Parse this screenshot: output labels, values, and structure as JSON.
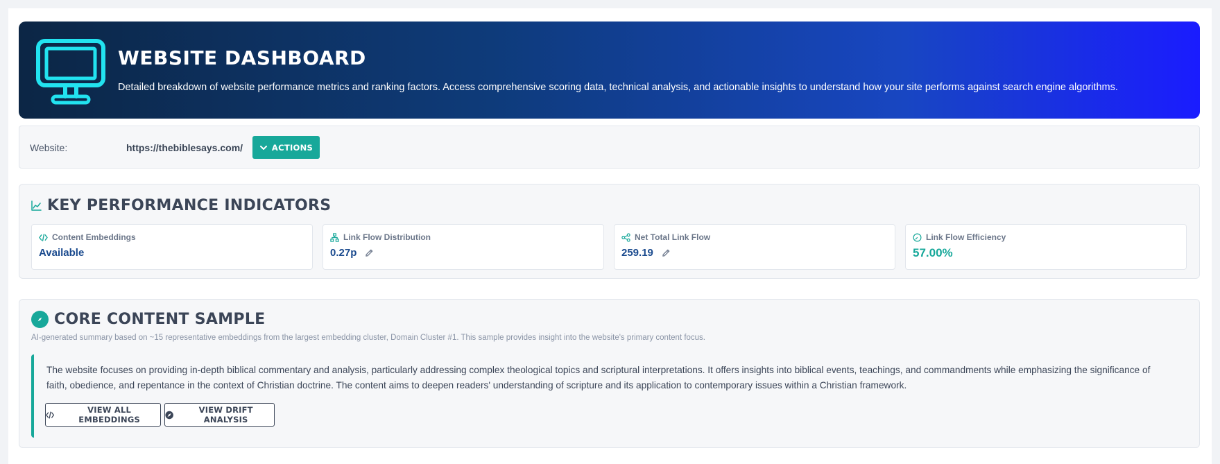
{
  "header": {
    "title": "WEBSITE DASHBOARD",
    "subtitle": "Detailed breakdown of website performance metrics and ranking factors. Access comprehensive scoring data, technical analysis, and actionable insights to understand how your site performs against search engine algorithms.",
    "icon": "monitor-icon"
  },
  "website": {
    "label": "Website:",
    "url": "https://thebiblesays.com/",
    "actions_label": "ACTIONS"
  },
  "kpi": {
    "title": "KEY PERFORMANCE INDICATORS",
    "cards": [
      {
        "label": "Content Embeddings",
        "value": "Available",
        "icon": "code-icon"
      },
      {
        "label": "Link Flow Distribution",
        "value": "0.27p",
        "icon": "sitemap-icon"
      },
      {
        "label": "Net Total Link Flow",
        "value": "259.19",
        "icon": "share-icon"
      },
      {
        "label": "Link Flow Efficiency",
        "value": "57.00%",
        "icon": "gauge-icon"
      }
    ]
  },
  "core": {
    "title": "CORE CONTENT SAMPLE",
    "subtitle": "AI-generated summary based on ~15 representative embeddings from the largest embedding cluster, Domain Cluster #1. This sample provides insight into the website's primary content focus.",
    "summary": "The website focuses on providing in-depth biblical commentary and analysis, particularly addressing complex theological topics and scriptural interpretations. It offers insights into biblical events, teachings, and commandments while emphasizing the significance of faith, obedience, and repentance in the context of Christian doctrine. The content aims to deepen readers' understanding of scripture and its application to contemporary issues within a Christian framework.",
    "view_embeddings_label": "VIEW ALL EMBEDDINGS",
    "view_drift_label": "VIEW DRIFT ANALYSIS"
  },
  "colors": {
    "accent": "#17a89a",
    "value_blue": "#1a4a8e",
    "hero_start": "#0c2645",
    "hero_end": "#1a1cff",
    "icon_cyan": "#22e3f0"
  }
}
